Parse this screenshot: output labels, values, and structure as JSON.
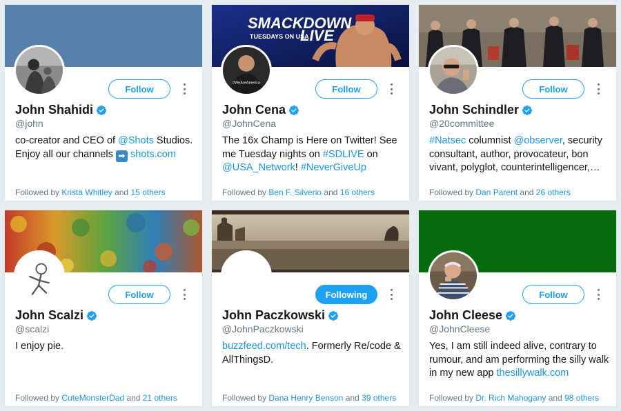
{
  "cards": [
    {
      "name": "John Shahidi",
      "handle": "@john",
      "follow_label": "Follow",
      "bio": {
        "t1": "co-creator and CEO of ",
        "l1": "@Shots",
        "t2": " Studios. Enjoy all our channels ",
        "emoji": "➡",
        "t3": " ",
        "l2": "shots.com"
      },
      "followed_prefix": "Followed by ",
      "followed_name": "Krista Whitley",
      "followed_and": " and ",
      "followed_count": "15 others",
      "banner_color": "#5780ac"
    },
    {
      "name": "John Cena",
      "handle": "@JohnCena",
      "follow_label": "Follow",
      "bio": {
        "t1": "The 16x Champ is Here on Twitter! See me Tuesday nights on ",
        "l1": "#SDLIVE",
        "t2": " on ",
        "l2": "@USA_Network",
        "t3": "! ",
        "l3": "#NeverGiveUp"
      },
      "banner_text": {
        "line1": "SMACKDOWN",
        "line2": "TUESDAYS ON USA",
        "line3": "LIVE"
      },
      "avatar_caption": "#WeAreAmerica",
      "followed_prefix": "Followed by ",
      "followed_name": "Ben F. Silverio",
      "followed_and": " and ",
      "followed_count": "16 others"
    },
    {
      "name": "John Schindler",
      "handle": "@20committee",
      "follow_label": "Follow",
      "bio": {
        "l1": "#Natsec",
        "t1": " columnist ",
        "l2": "@observer",
        "t2": ", security consultant, author, provocateur, bon vivant, polyglot, counterintelligencer,…"
      },
      "followed_prefix": "Followed by ",
      "followed_name": "Dan Parent",
      "followed_and": " and ",
      "followed_count": "26 others"
    },
    {
      "name": "John Scalzi",
      "handle": "@scalzi",
      "follow_label": "Follow",
      "bio": {
        "t1": "I enjoy pie."
      },
      "followed_prefix": "Followed by ",
      "followed_name": "CuteMonsterDad",
      "followed_and": " and ",
      "followed_count": "21 others"
    },
    {
      "name": "John Paczkowski",
      "handle": "@JohnPaczkowski",
      "follow_label": "Following",
      "bio": {
        "l1": "buzzfeed.com/tech",
        "t1": ". Formerly Re/code & AllThingsD."
      },
      "followed_prefix": "Followed by ",
      "followed_name": "Dana Henry Benson",
      "followed_and": " and ",
      "followed_count": "39 others"
    },
    {
      "name": "John Cleese",
      "handle": "@JohnCleese",
      "follow_label": "Follow",
      "bio": {
        "t1": "Yes, I am still indeed alive, contrary to rumour, and am performing the silly walk in my new app ",
        "l1": "thesillywalk.com"
      },
      "followed_prefix": "Followed by ",
      "followed_name": "Dr. Rich Mahogany",
      "followed_and": " and ",
      "followed_count": "98 others",
      "banner_color": "#056b0d"
    }
  ],
  "icons": {
    "verified": "verified-badge-icon",
    "more": "more-vertical-icon"
  },
  "colors": {
    "accent": "#1da1f2",
    "link": "#1b95e0",
    "muted": "#657786",
    "background": "#e6ecf0"
  }
}
